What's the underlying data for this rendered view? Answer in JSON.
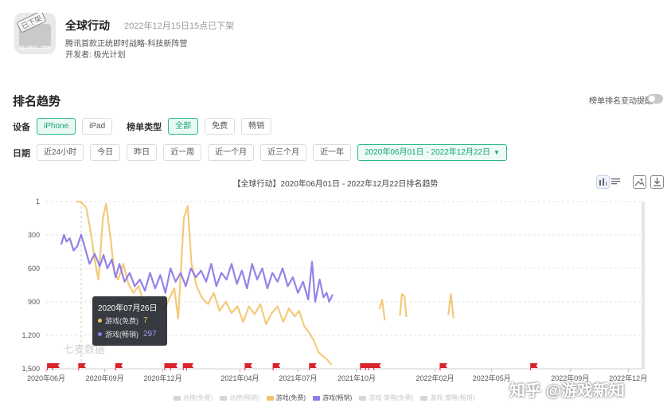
{
  "app": {
    "name": "全球行动",
    "status": "2022年12月15日15点已下架",
    "description": "腾讯首款正统即时战略-科技新阵营",
    "developer": "开发者: 极光计划",
    "icon_stamp": "已下架",
    "icon_caption": "GLOBAL OPS"
  },
  "section": {
    "title": "排名趋势",
    "alert_label": "榜单排名变动提醒"
  },
  "filters": {
    "device_label": "设备",
    "devices": [
      "iPhone",
      "iPad"
    ],
    "list_type_label": "榜单类型",
    "list_types": [
      "全部",
      "免费",
      "畅销"
    ],
    "date_label": "日期",
    "date_ranges": [
      "近24小时",
      "今日",
      "昨日",
      "近一周",
      "近一个月",
      "近三个月",
      "近一年"
    ],
    "date_picker": "2020年06月01日 - 2022年12月22日"
  },
  "tools": {
    "chart_type_icon": "bar-chart-icon",
    "list_icon": "list-icon",
    "save_image_icon": "image-icon",
    "download_icon": "download-icon"
  },
  "tooltip": {
    "date": "2020年07月26日",
    "rows": [
      {
        "label": "游戏(免费)",
        "value": "7",
        "color": "#f2c46b"
      },
      {
        "label": "游戏(畅销)",
        "value": "297",
        "color": "#8f7be6"
      }
    ]
  },
  "watermarks": {
    "left": "七麦数据",
    "right": "知乎 @游戏新知"
  },
  "colors": {
    "accent": "#2cb88a",
    "free": "#f2c46b",
    "grossing": "#8f7be6",
    "marker": "#d9232a",
    "disabled": "#d6d6d6"
  },
  "chart_data": {
    "type": "line",
    "title": "【全球行动】2020年06月01日 - 2022年12月22日排名趋势",
    "y_reversed": true,
    "ylim": [
      1,
      1500
    ],
    "y_ticks": [
      "1",
      "300",
      "600",
      "900",
      "1,200",
      "1,500"
    ],
    "y_tick_values": [
      1,
      300,
      600,
      900,
      1200,
      1500
    ],
    "x_ticks": [
      "2020年06月",
      "2020年09月",
      "2020年12月",
      "2021年04月",
      "2021年07月",
      "2021年10月",
      "2022年02月",
      "2022年05月",
      "2022年09月",
      "2022年12月"
    ],
    "x_tick_dates": [
      "2020-06-01",
      "2020-09-01",
      "2020-12-01",
      "2021-04-01",
      "2021-07-01",
      "2021-10-01",
      "2022-02-01",
      "2022-05-01",
      "2022-09-01",
      "2022-12-01"
    ],
    "legend": [
      "总榜(免费)",
      "总榜(畅销)",
      "游戏(免费)",
      "游戏(畅销)",
      "游戏-策略(免费)",
      "游戏-策略(畅销)"
    ],
    "legend_active": [
      false,
      false,
      true,
      true,
      false,
      false
    ],
    "grid": true,
    "event_marker_dates": [
      "2020-06-08",
      "2020-06-16",
      "2020-07-27",
      "2020-09-23",
      "2020-12-09",
      "2020-12-18",
      "2021-01-07",
      "2021-01-12",
      "2021-04-14",
      "2021-05-28",
      "2021-07-24",
      "2021-10-12",
      "2021-10-20",
      "2021-10-25",
      "2021-11-02",
      "2022-02-14",
      "2022-07-06"
    ],
    "series": [
      {
        "name": "游戏(免费)",
        "points": [
          [
            "2020-07-20",
            1
          ],
          [
            "2020-07-26",
            7
          ],
          [
            "2020-08-03",
            60
          ],
          [
            "2020-08-10",
            280
          ],
          [
            "2020-08-16",
            520
          ],
          [
            "2020-08-22",
            700
          ],
          [
            "2020-08-29",
            150
          ],
          [
            "2020-09-03",
            20
          ],
          [
            "2020-09-10",
            330
          ],
          [
            "2020-09-16",
            640
          ],
          [
            "2020-09-22",
            700
          ],
          [
            "2020-09-30",
            560
          ],
          [
            "2020-10-08",
            740
          ],
          [
            "2020-10-16",
            820
          ],
          [
            "2020-10-24",
            760
          ],
          [
            "2020-11-01",
            900
          ],
          [
            "2020-11-09",
            860
          ],
          [
            "2020-11-17",
            960
          ],
          [
            "2020-11-25",
            900
          ],
          [
            "2020-12-03",
            980
          ],
          [
            "2020-12-11",
            870
          ],
          [
            "2020-12-19",
            780
          ],
          [
            "2020-12-25",
            1050
          ],
          [
            "2021-01-03",
            150
          ],
          [
            "2021-01-09",
            40
          ],
          [
            "2021-01-15",
            560
          ],
          [
            "2021-01-23",
            760
          ],
          [
            "2021-02-01",
            870
          ],
          [
            "2021-02-10",
            920
          ],
          [
            "2021-02-19",
            820
          ],
          [
            "2021-02-28",
            980
          ],
          [
            "2021-03-10",
            900
          ],
          [
            "2021-03-19",
            1000
          ],
          [
            "2021-03-28",
            940
          ],
          [
            "2021-04-06",
            1080
          ],
          [
            "2021-04-15",
            940
          ],
          [
            "2021-04-24",
            1010
          ],
          [
            "2021-05-03",
            920
          ],
          [
            "2021-05-12",
            1100
          ],
          [
            "2021-05-21",
            1000
          ],
          [
            "2021-05-30",
            940
          ],
          [
            "2021-06-08",
            1080
          ],
          [
            "2021-06-17",
            960
          ],
          [
            "2021-06-26",
            1030
          ],
          [
            "2021-07-03",
            980
          ],
          [
            "2021-07-11",
            1120
          ],
          [
            "2021-07-19",
            1180
          ],
          [
            "2021-07-26",
            1250
          ],
          [
            "2021-08-02",
            1350
          ],
          [
            "2021-08-10",
            1390
          ],
          [
            "2021-08-16",
            1420
          ],
          [
            "2021-08-22",
            1460
          ]
        ]
      },
      {
        "name": "游戏(畅销)",
        "points": [
          [
            "2020-06-25",
            380
          ],
          [
            "2020-06-29",
            300
          ],
          [
            "2020-07-03",
            360
          ],
          [
            "2020-07-08",
            330
          ],
          [
            "2020-07-14",
            440
          ],
          [
            "2020-07-20",
            400
          ],
          [
            "2020-07-26",
            297
          ],
          [
            "2020-08-01",
            420
          ],
          [
            "2020-08-08",
            560
          ],
          [
            "2020-08-16",
            470
          ],
          [
            "2020-08-24",
            580
          ],
          [
            "2020-08-30",
            480
          ],
          [
            "2020-09-05",
            600
          ],
          [
            "2020-09-12",
            520
          ],
          [
            "2020-09-18",
            680
          ],
          [
            "2020-09-24",
            560
          ],
          [
            "2020-10-02",
            720
          ],
          [
            "2020-10-10",
            640
          ],
          [
            "2020-10-18",
            760
          ],
          [
            "2020-10-26",
            700
          ],
          [
            "2020-11-03",
            800
          ],
          [
            "2020-11-11",
            640
          ],
          [
            "2020-11-19",
            780
          ],
          [
            "2020-11-27",
            660
          ],
          [
            "2020-12-05",
            820
          ],
          [
            "2020-12-13",
            600
          ],
          [
            "2020-12-21",
            720
          ],
          [
            "2020-12-29",
            640
          ],
          [
            "2021-01-06",
            760
          ],
          [
            "2021-01-14",
            600
          ],
          [
            "2021-01-22",
            680
          ],
          [
            "2021-01-30",
            620
          ],
          [
            "2021-02-07",
            720
          ],
          [
            "2021-02-15",
            560
          ],
          [
            "2021-02-23",
            760
          ],
          [
            "2021-03-03",
            640
          ],
          [
            "2021-03-11",
            700
          ],
          [
            "2021-03-19",
            560
          ],
          [
            "2021-03-27",
            740
          ],
          [
            "2021-04-04",
            620
          ],
          [
            "2021-04-12",
            780
          ],
          [
            "2021-04-20",
            560
          ],
          [
            "2021-04-28",
            700
          ],
          [
            "2021-05-06",
            600
          ],
          [
            "2021-05-14",
            780
          ],
          [
            "2021-05-22",
            640
          ],
          [
            "2021-05-30",
            720
          ],
          [
            "2021-06-07",
            600
          ],
          [
            "2021-06-15",
            760
          ],
          [
            "2021-06-23",
            680
          ],
          [
            "2021-07-01",
            820
          ],
          [
            "2021-07-09",
            720
          ],
          [
            "2021-07-17",
            880
          ],
          [
            "2021-07-23",
            540
          ],
          [
            "2021-07-28",
            900
          ],
          [
            "2021-08-04",
            700
          ],
          [
            "2021-08-10",
            860
          ],
          [
            "2021-08-15",
            820
          ],
          [
            "2021-08-19",
            900
          ],
          [
            "2021-08-24",
            840
          ]
        ]
      },
      {
        "name": "游戏(免费)",
        "points": [
          [
            "2021-11-06",
            960
          ],
          [
            "2021-11-10",
            880
          ],
          [
            "2021-11-14",
            1060
          ]
        ]
      },
      {
        "name": "游戏(免费)",
        "points": [
          [
            "2021-12-08",
            1020
          ],
          [
            "2021-12-11",
            830
          ],
          [
            "2021-12-15",
            850
          ],
          [
            "2021-12-18",
            1030
          ]
        ]
      },
      {
        "name": "游戏(免费)",
        "points": [
          [
            "2022-02-22",
            1010
          ],
          [
            "2022-02-26",
            830
          ],
          [
            "2022-03-02",
            1040
          ]
        ]
      }
    ]
  }
}
